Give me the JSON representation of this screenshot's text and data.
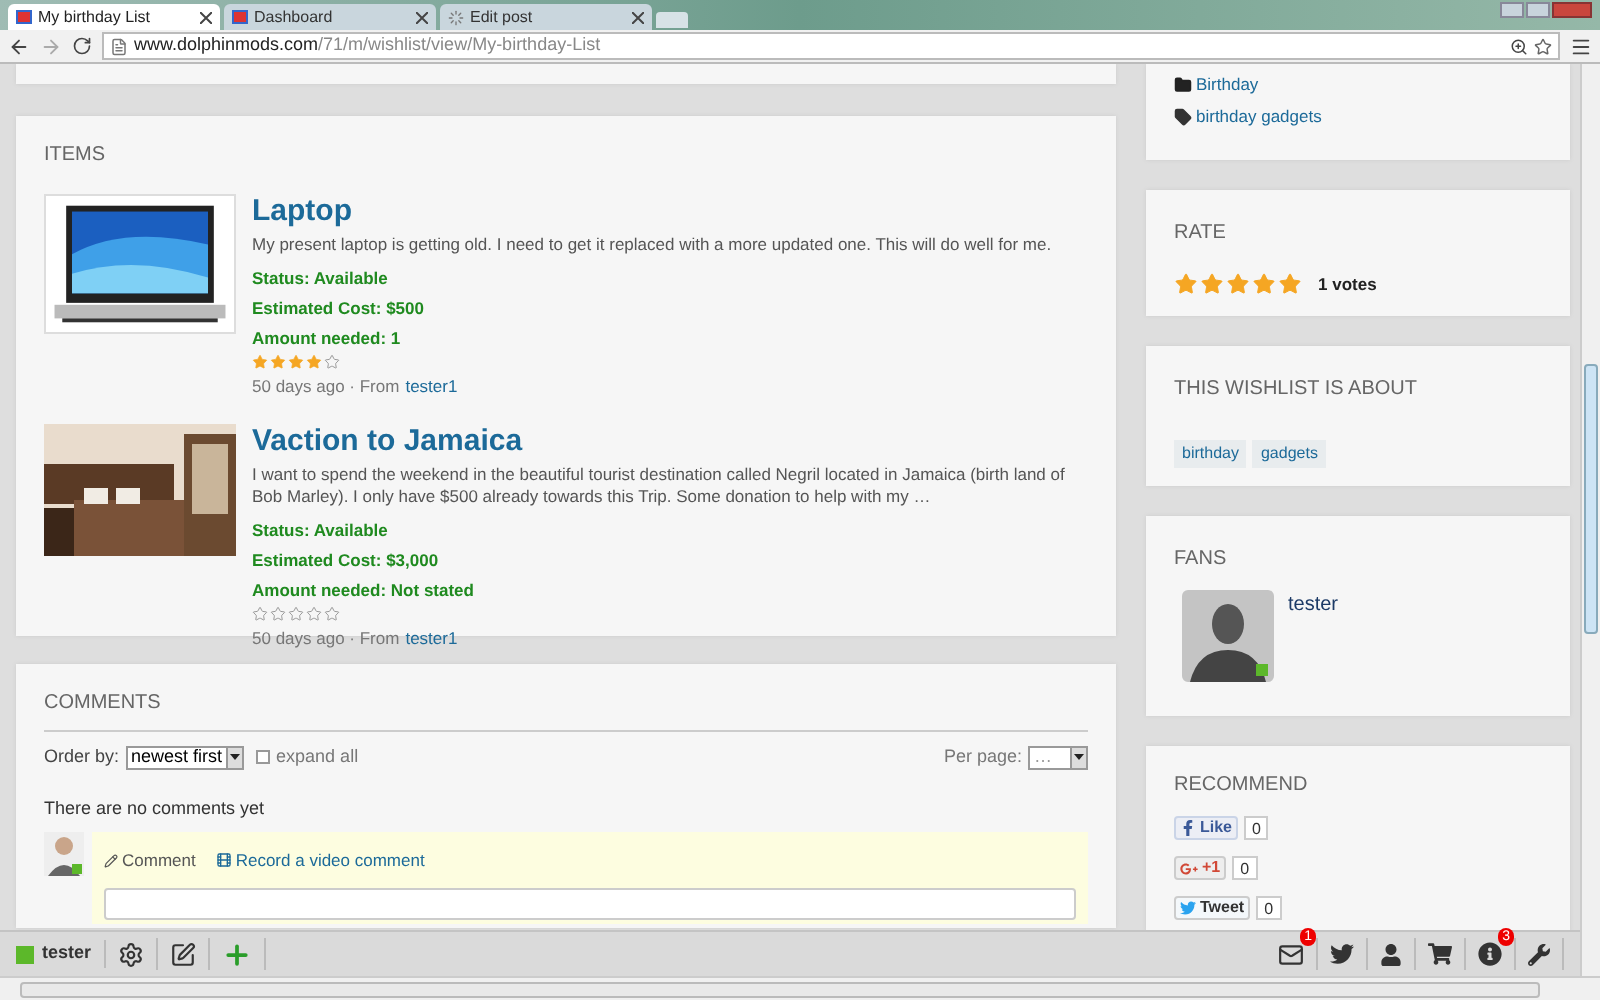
{
  "browser": {
    "tabs": [
      {
        "title": "My birthday List",
        "selected": true,
        "kind": "page"
      },
      {
        "title": "Dashboard",
        "selected": false,
        "kind": "page"
      },
      {
        "title": "Edit post",
        "selected": false,
        "kind": "loading"
      }
    ],
    "url": {
      "domain": "www.dolphinmods.com",
      "path": "/71/m/wishlist/view/My-birthday-List"
    }
  },
  "items_card": {
    "heading": "ITEMS",
    "items": [
      {
        "kind": "picture",
        "title": "Laptop",
        "description": "My present laptop is getting old. I need to get it replaced with a more updated one. This will do well for me.",
        "status": "Status: Available",
        "cost": "Estimated Cost: $500",
        "amount": "Amount needed: 1",
        "stars": 4,
        "meta": "50 days ago · From",
        "user": "tester1"
      },
      {
        "kind": "picture",
        "title": "Vaction to Jamaica",
        "description": "I want to spend the weekend in the beautiful tourist destination called Negril located in Jamaica (birth land of Bob Marley). I only have $500 already towards this Trip. Some donation to help with my …",
        "status": "Status: Available",
        "cost": "Estimated Cost: $3,000",
        "amount": "Amount needed: Not stated",
        "stars": 0,
        "meta": "50 days ago · From",
        "user": "tester1"
      }
    ]
  },
  "comments": {
    "heading": "COMMENTS",
    "order_label": "Order by:",
    "order_value": "newest first",
    "expand": {
      "label": "expand all",
      "checked": false
    },
    "per_page_label": "Per page:",
    "per_page_value": "…",
    "empty": "There are no comments yet",
    "actions": [
      {
        "kind": "text",
        "label": "Comment"
      },
      {
        "kind": "video",
        "label": "Record a video comment"
      }
    ]
  },
  "sidebar": {
    "categories": [
      {
        "kind": "folder",
        "label": "Birthday"
      },
      {
        "kind": "tag",
        "label": "birthday gadgets"
      }
    ],
    "rate": {
      "heading": "RATE",
      "stars": 5,
      "votes": "1 votes"
    },
    "about": {
      "heading": "THIS WISHLIST IS ABOUT",
      "tags": [
        "birthday",
        "gadgets"
      ]
    },
    "fans": {
      "heading": "FANS",
      "users": [
        {
          "name": "tester"
        }
      ]
    },
    "recommend": {
      "heading": "RECOMMEND",
      "buttons": [
        {
          "kind": "facebook",
          "label": "Like",
          "count": "0"
        },
        {
          "kind": "google",
          "label": "+1",
          "count": "0"
        },
        {
          "kind": "twitter",
          "label": "Tweet",
          "count": "0"
        }
      ]
    }
  },
  "toolbar": {
    "user": "tester",
    "left": [
      {
        "kind": "settings"
      },
      {
        "kind": "edit"
      },
      {
        "kind": "add"
      }
    ],
    "right": [
      {
        "kind": "mail",
        "badge": "1"
      },
      {
        "kind": "twitter"
      },
      {
        "kind": "user"
      },
      {
        "kind": "cart"
      },
      {
        "kind": "info",
        "badge": "3"
      },
      {
        "kind": "wrench"
      }
    ]
  }
}
